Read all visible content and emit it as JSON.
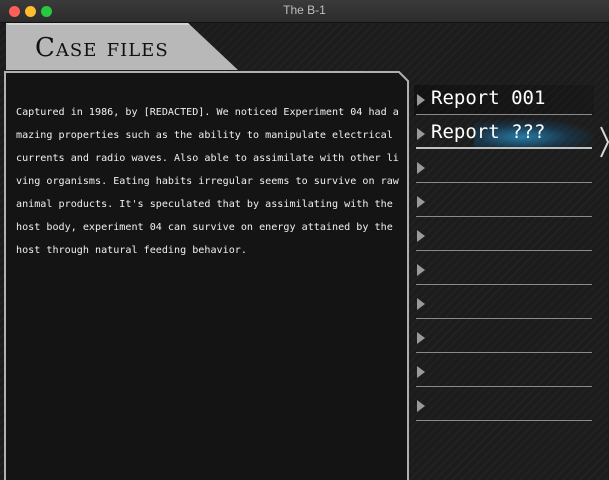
{
  "window": {
    "title": "The B-1"
  },
  "header": {
    "title": "Case files"
  },
  "case": {
    "text": "Captured in 1986, by [REDACTED]. We noticed Experiment 04 had amazing properties such as the ability to manipulate electrical currents and radio waves. Also able to assimilate with other living organisms. Eating habits irregular seems to survive on raw animal products. It's speculated that by assimilating with the host body, experiment 04 can survive on energy attained by the host through natural feeding behavior."
  },
  "reports": [
    {
      "label": "Report 001",
      "selected": false
    },
    {
      "label": "Report ???",
      "selected": true
    },
    {
      "label": "",
      "selected": false
    },
    {
      "label": "",
      "selected": false
    },
    {
      "label": "",
      "selected": false
    },
    {
      "label": "",
      "selected": false
    },
    {
      "label": "",
      "selected": false
    },
    {
      "label": "",
      "selected": false
    },
    {
      "label": "",
      "selected": false
    },
    {
      "label": "",
      "selected": false
    }
  ],
  "colors": {
    "header_tab": "#b8b8b8",
    "panel_bg": "#141414",
    "panel_border": "#b0b0b0",
    "selection_glow": "#2a8cbe",
    "text": "#f0f0f0"
  },
  "icons": {
    "report_marker": "triangle-right-icon",
    "scroll_cursor": "chevron-right-icon"
  }
}
